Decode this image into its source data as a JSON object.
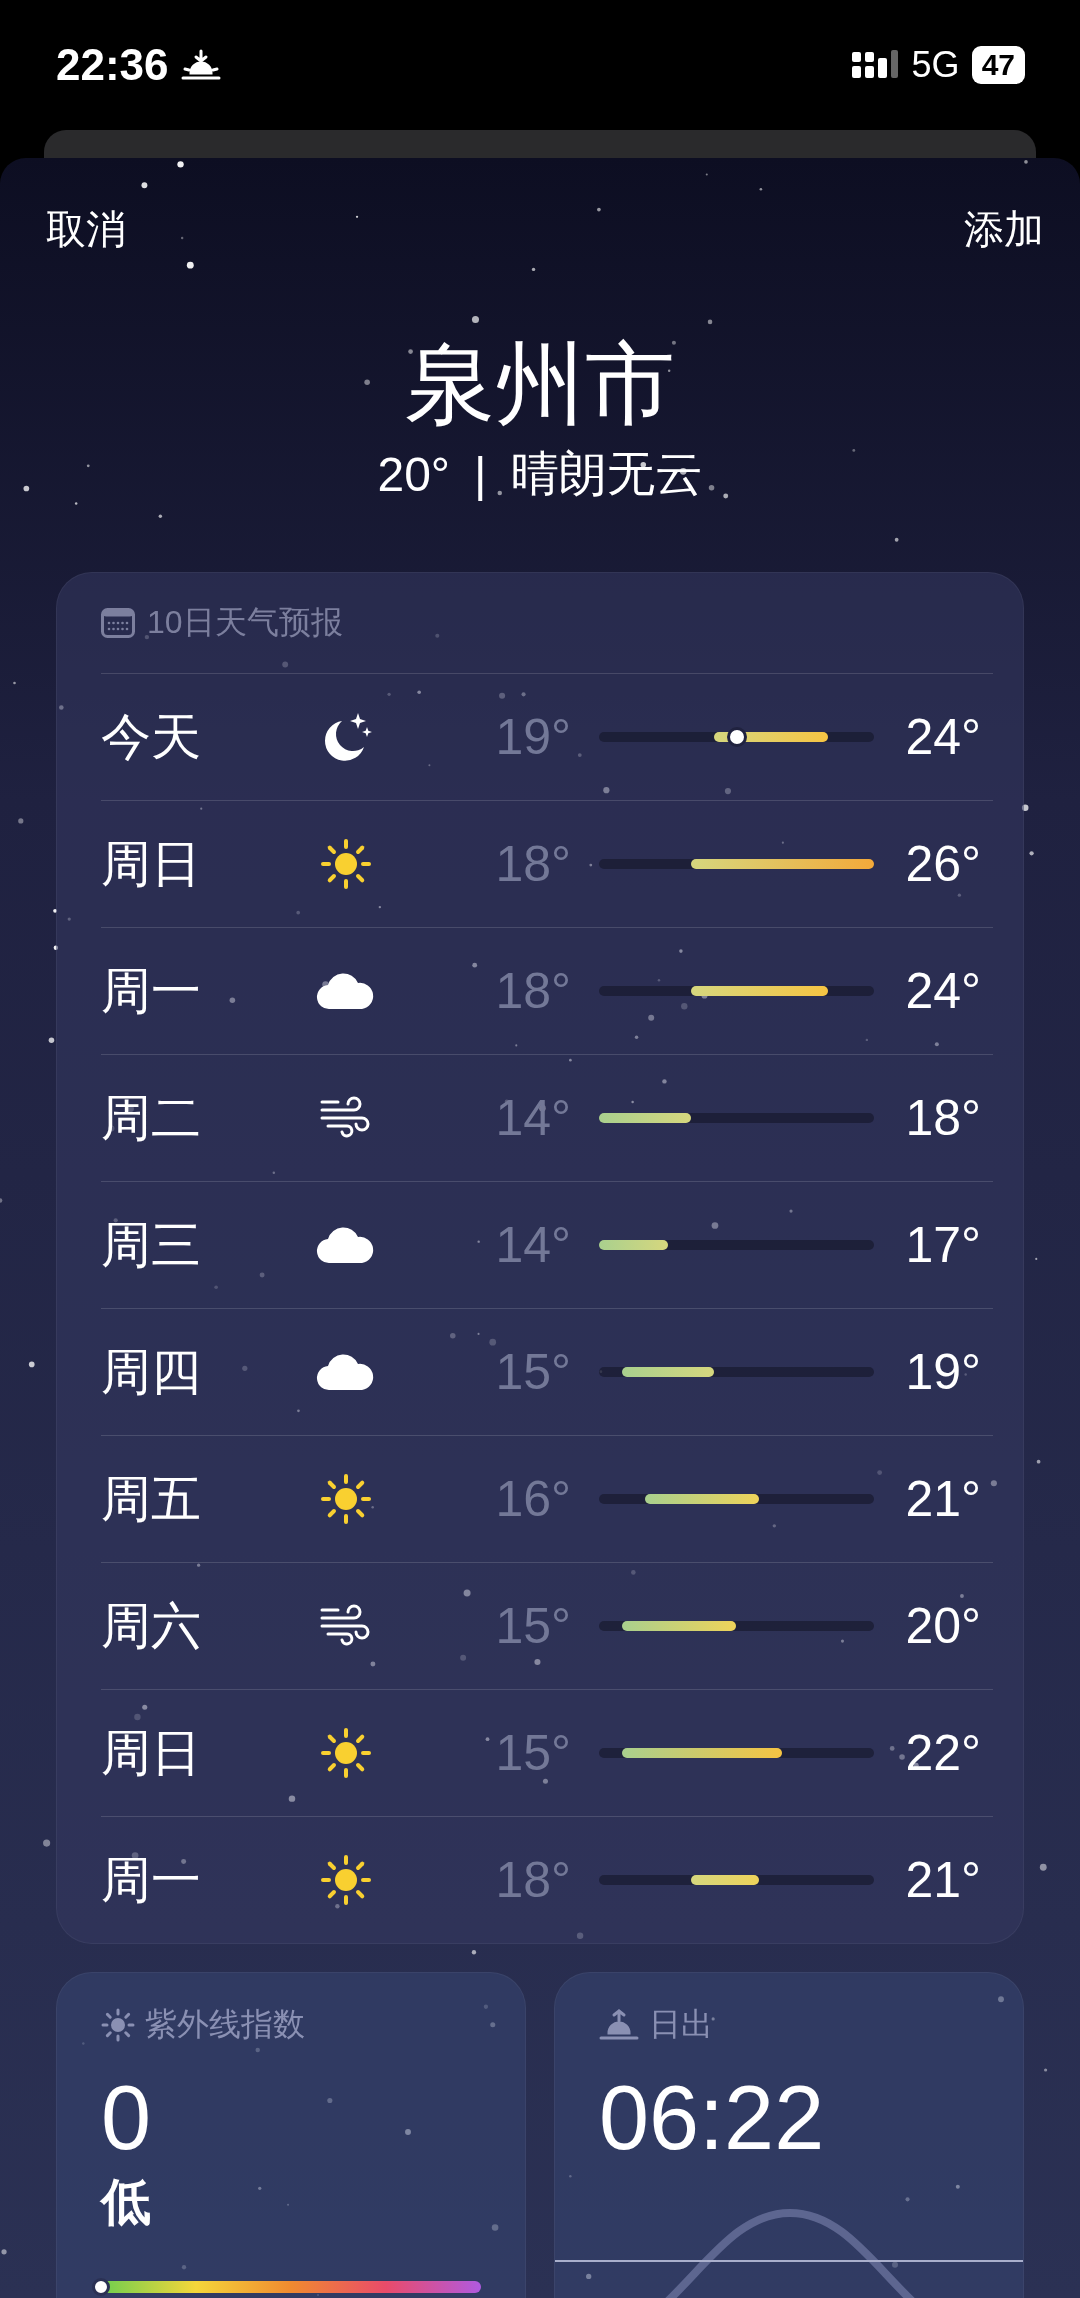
{
  "status_bar": {
    "time": "22:36",
    "network": "5G",
    "battery": "47"
  },
  "nav": {
    "cancel": "取消",
    "add": "添加"
  },
  "location": {
    "city": "泉州市",
    "temperature": "20°",
    "separator": "|",
    "condition": "晴朗无云"
  },
  "forecast": {
    "title": "10日天气预报",
    "days": [
      {
        "day": "今天",
        "kind": "clear-night",
        "low": "19°",
        "high": "24°",
        "current": true
      },
      {
        "day": "周日",
        "kind": "sunny",
        "low": "18°",
        "high": "26°",
        "current": false
      },
      {
        "day": "周一",
        "kind": "cloudy",
        "low": "18°",
        "high": "24°",
        "current": false
      },
      {
        "day": "周二",
        "kind": "windy",
        "low": "14°",
        "high": "18°",
        "current": false
      },
      {
        "day": "周三",
        "kind": "cloudy",
        "low": "14°",
        "high": "17°",
        "current": false
      },
      {
        "day": "周四",
        "kind": "cloudy",
        "low": "15°",
        "high": "19°",
        "current": false
      },
      {
        "day": "周五",
        "kind": "sunny",
        "low": "16°",
        "high": "21°",
        "current": false
      },
      {
        "day": "周六",
        "kind": "windy",
        "low": "15°",
        "high": "20°",
        "current": false
      },
      {
        "day": "周日",
        "kind": "sunny",
        "low": "15°",
        "high": "22°",
        "current": false
      },
      {
        "day": "周一",
        "kind": "sunny",
        "low": "18°",
        "high": "21°",
        "current": false
      }
    ]
  },
  "uv": {
    "title": "紫外线指数",
    "value": "0",
    "label": "低",
    "level": 0
  },
  "sunrise": {
    "title": "日出",
    "time": "06:22"
  }
}
